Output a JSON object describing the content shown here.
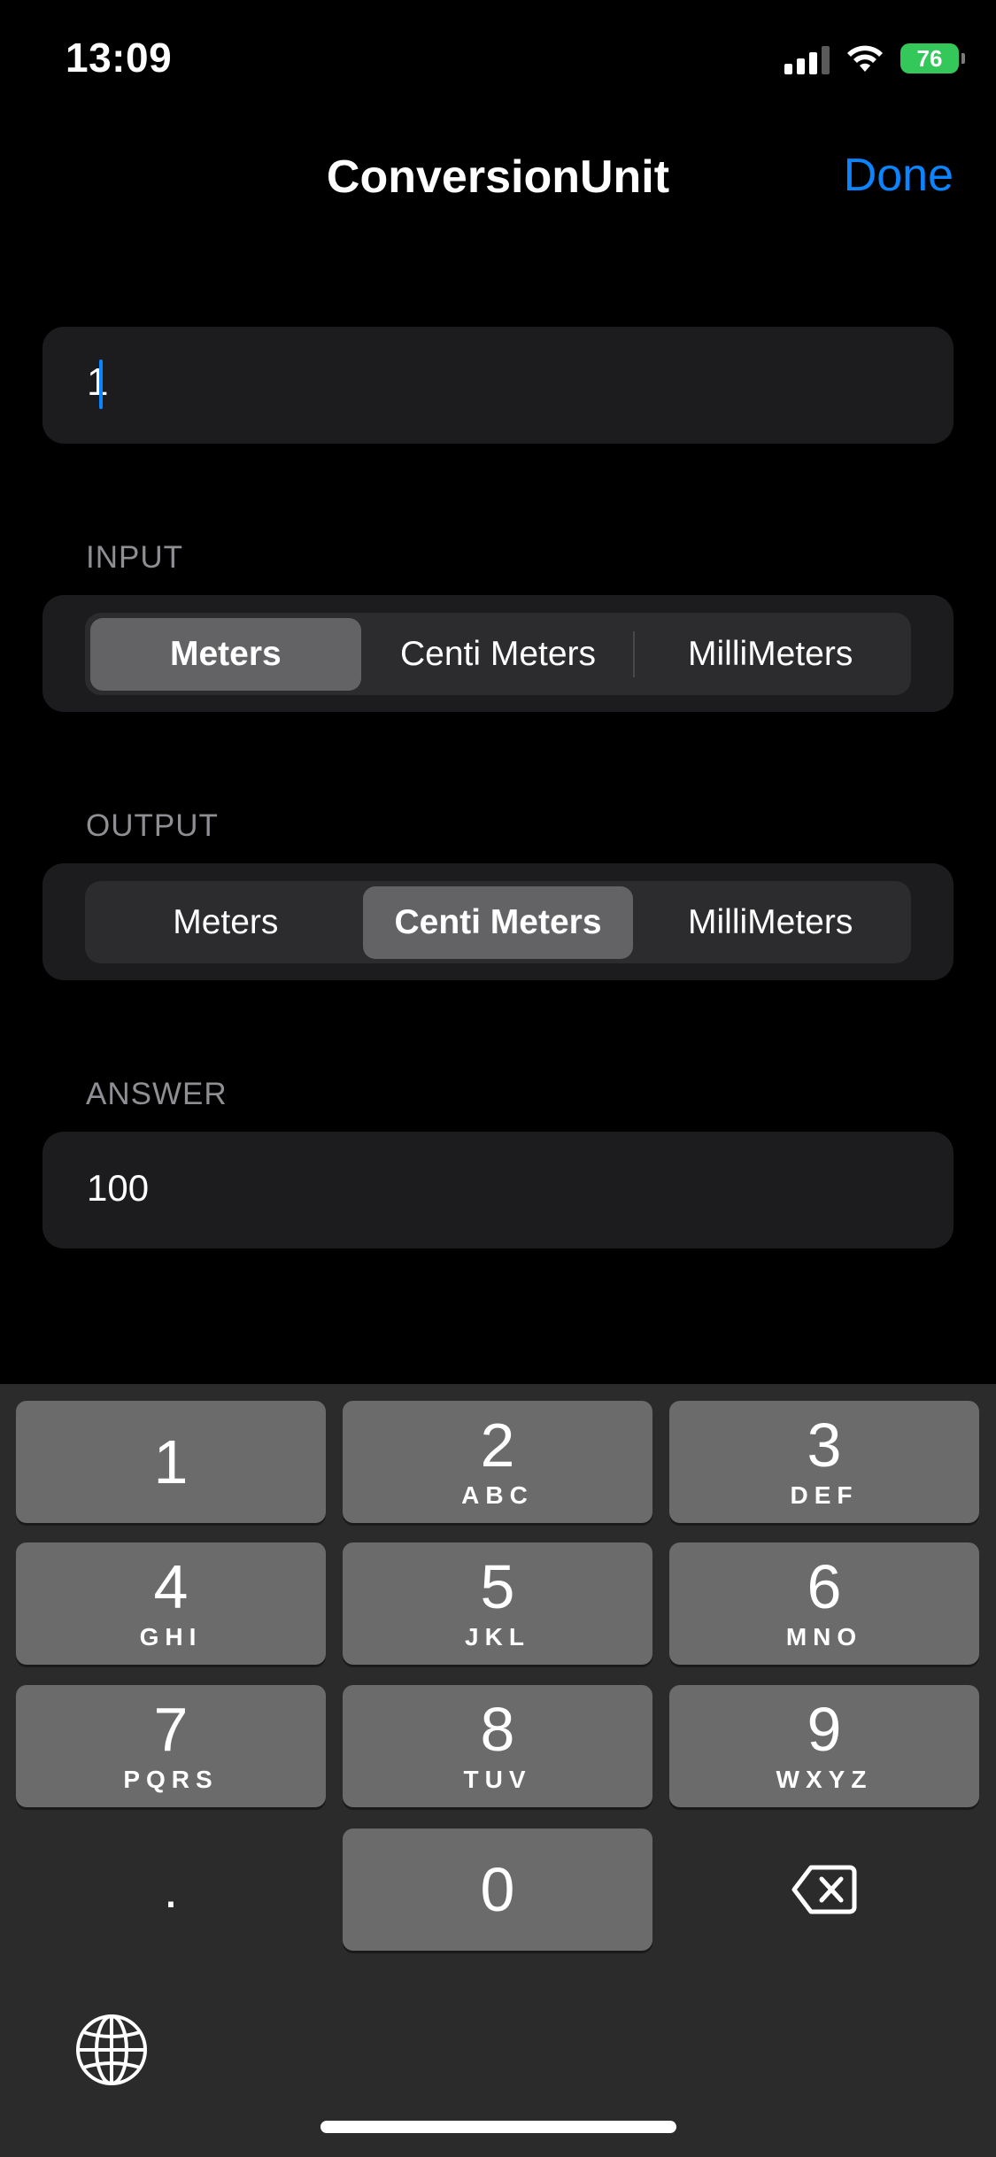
{
  "status": {
    "time": "13:09",
    "battery": "76",
    "battery_color": "#34c759"
  },
  "nav": {
    "title": "ConversionUnit",
    "done_label": "Done"
  },
  "input_field": {
    "value": "1"
  },
  "input_section": {
    "label": "INPUT",
    "options": [
      "Meters",
      "Centi Meters",
      "MilliMeters"
    ],
    "selected": "Meters"
  },
  "output_section": {
    "label": "OUTPUT",
    "options": [
      "Meters",
      "Centi Meters",
      "MilliMeters"
    ],
    "selected": "Centi Meters"
  },
  "answer_section": {
    "label": "ANSWER",
    "value": "100"
  },
  "keyboard": {
    "keys": [
      {
        "num": "1",
        "letters": ""
      },
      {
        "num": "2",
        "letters": "ABC"
      },
      {
        "num": "3",
        "letters": "DEF"
      },
      {
        "num": "4",
        "letters": "GHI"
      },
      {
        "num": "5",
        "letters": "JKL"
      },
      {
        "num": "6",
        "letters": "MNO"
      },
      {
        "num": "7",
        "letters": "PQRS"
      },
      {
        "num": "8",
        "letters": "TUV"
      },
      {
        "num": "9",
        "letters": "WXYZ"
      },
      {
        "num": "0",
        "letters": ""
      }
    ],
    "decimal": ".",
    "accent": "#0a84ff"
  }
}
